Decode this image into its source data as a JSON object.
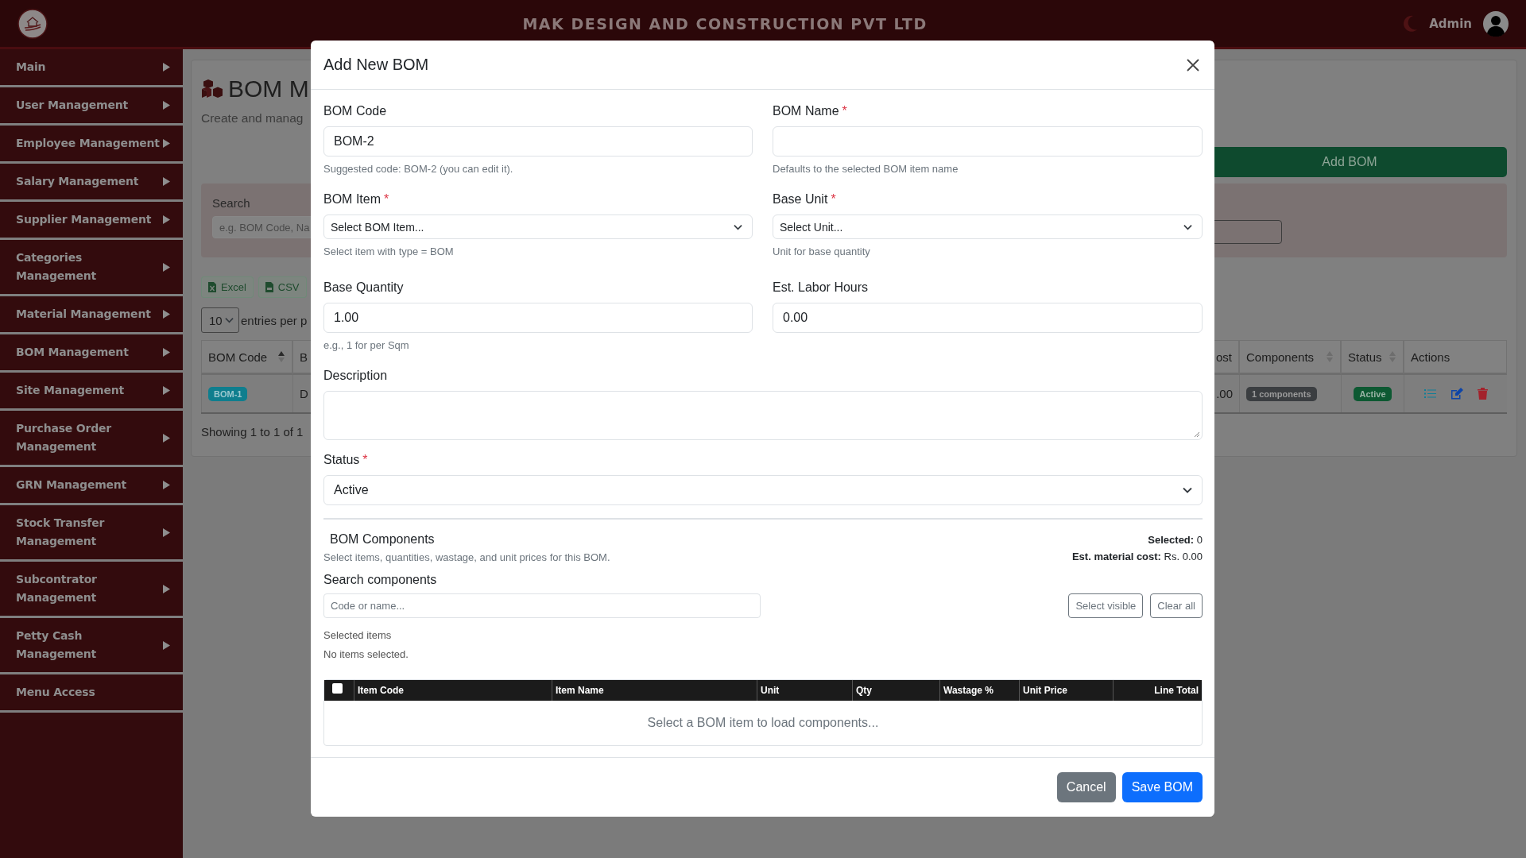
{
  "header": {
    "title": "MAK DESIGN AND CONSTRUCTION PVT LTD",
    "user": "Admin"
  },
  "sidebar": {
    "items": [
      {
        "label": "Main",
        "expandable": true
      },
      {
        "label": "User Management",
        "expandable": true
      },
      {
        "label": "Employee Management",
        "expandable": true
      },
      {
        "label": "Salary Management",
        "expandable": true
      },
      {
        "label": "Supplier Management",
        "expandable": true
      },
      {
        "label": "Categories Management",
        "expandable": true
      },
      {
        "label": "Material Management",
        "expandable": true
      },
      {
        "label": "BOM Management",
        "expandable": true
      },
      {
        "label": "Site Management",
        "expandable": true
      },
      {
        "label": "Purchase Order Management",
        "expandable": true
      },
      {
        "label": "GRN Management",
        "expandable": true
      },
      {
        "label": "Stock Transfer Management",
        "expandable": true
      },
      {
        "label": "Subcontrator Management",
        "expandable": true
      },
      {
        "label": "Petty Cash Management",
        "expandable": true
      },
      {
        "label": "Menu Access",
        "expandable": false
      }
    ]
  },
  "page": {
    "title": "BOM M",
    "subtitle": "Create and manag",
    "add_button": "Add BOM",
    "search": {
      "label": "Search",
      "placeholder": "e.g. BOM Code, Na"
    },
    "export_buttons": [
      {
        "label": "Excel",
        "kind": "excel"
      },
      {
        "label": "CSV",
        "kind": "csv"
      }
    ],
    "page_size": "10",
    "page_size_label": "entries per p",
    "table": {
      "columns": [
        {
          "label": "BOM Code",
          "sortable": true,
          "sorted": true
        },
        {
          "label": "B",
          "sortable": false
        },
        {
          "label": "ost",
          "sortable": false
        },
        {
          "label": "Components",
          "sortable": true,
          "sorted": false
        },
        {
          "label": "Status",
          "sortable": true,
          "sorted": false
        },
        {
          "label": "Actions",
          "sortable": false
        }
      ],
      "rows": [
        {
          "code": "BOM-1",
          "column_2": "D",
          "cost": ".00",
          "components": "1 components",
          "status": "Active"
        }
      ]
    },
    "info": "Showing 1 to 1 of 1"
  },
  "modal": {
    "title": "Add New BOM",
    "required_mark": "*",
    "fields": [
      {
        "kind": "input",
        "label": "BOM Code",
        "required": false,
        "value": "BOM-2",
        "help": "Suggested code: BOM-2 (you can edit it)."
      },
      {
        "kind": "input",
        "label": "BOM Name",
        "required": true,
        "help": "Defaults to the selected BOM item name"
      },
      {
        "kind": "small-select",
        "label": "BOM Item",
        "required": true,
        "value": "Select BOM Item...",
        "help": "Select item with type = BOM"
      },
      {
        "kind": "small-select",
        "label": "Base Unit",
        "required": true,
        "value": "Select Unit...",
        "help": "Unit for base quantity"
      },
      {
        "kind": "input",
        "label": "Base Quantity",
        "required": false,
        "value": "1.00",
        "help": "e.g., 1 for per Sqm"
      },
      {
        "kind": "input",
        "label": "Est. Labor Hours",
        "required": false,
        "value": "0.00"
      },
      {
        "kind": "textarea",
        "label": "Description",
        "required": false
      },
      {
        "kind": "select",
        "label": "Status",
        "required": true,
        "value": "Active"
      }
    ],
    "components": {
      "title": "BOM Components",
      "subtitle": "Select items, quantities, wastage, and unit prices for this BOM.",
      "summary": [
        {
          "label": "Selected:",
          "value": "0"
        },
        {
          "label": "Est. material cost:",
          "value": "Rs. 0.00"
        }
      ],
      "search_label": "Search components",
      "search_placeholder": "Code or name...",
      "buttons": [
        "Select visible",
        "Clear all"
      ],
      "selected_label": "Selected items",
      "selected_empty": "No items selected.",
      "select_all_checked": false,
      "columns": [
        "Item Code",
        "Item Name",
        "Unit",
        "Qty",
        "Wastage %",
        "Unit Price",
        "Line Total"
      ],
      "empty": "Select a BOM item to load components..."
    },
    "buttons": [
      {
        "label": "Cancel",
        "kind": "secondary"
      },
      {
        "label": "Save BOM",
        "kind": "primary"
      }
    ]
  }
}
